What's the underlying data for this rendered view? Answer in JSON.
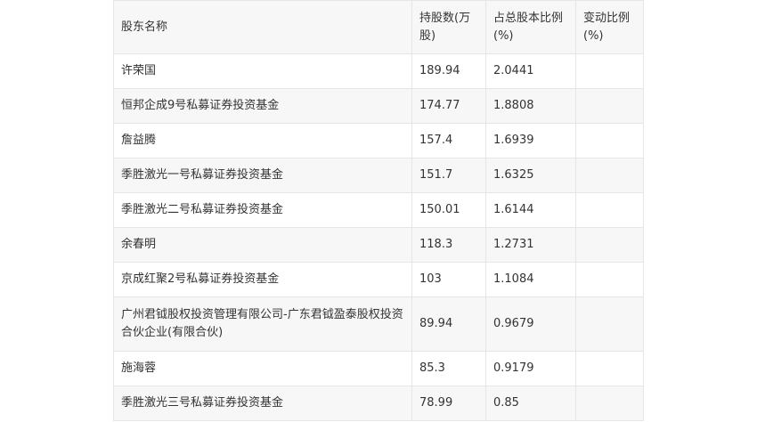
{
  "table": {
    "headers": {
      "name": "股东名称",
      "shares": "持股数(万股)",
      "ratio": "占总股本比例(%)",
      "change": "变动比例(%)"
    },
    "rows": [
      {
        "name": "许荣国",
        "shares": "189.94",
        "ratio": "2.0441",
        "change": ""
      },
      {
        "name": "恒邦企成9号私募证券投资基金",
        "shares": "174.77",
        "ratio": "1.8808",
        "change": ""
      },
      {
        "name": "詹益腾",
        "shares": "157.4",
        "ratio": "1.6939",
        "change": ""
      },
      {
        "name": "季胜激光一号私募证券投资基金",
        "shares": "151.7",
        "ratio": "1.6325",
        "change": ""
      },
      {
        "name": "季胜激光二号私募证券投资基金",
        "shares": "150.01",
        "ratio": "1.6144",
        "change": ""
      },
      {
        "name": "余春明",
        "shares": "118.3",
        "ratio": "1.2731",
        "change": ""
      },
      {
        "name": "京成红聚2号私募证券投资基金",
        "shares": "103",
        "ratio": "1.1084",
        "change": ""
      },
      {
        "name": "广州君钺股权投资管理有限公司-广东君钺盈泰股权投资合伙企业(有限合伙)",
        "shares": "89.94",
        "ratio": "0.9679",
        "change": ""
      },
      {
        "name": "施海蓉",
        "shares": "85.3",
        "ratio": "0.9179",
        "change": ""
      },
      {
        "name": "季胜激光三号私募证券投资基金",
        "shares": "78.99",
        "ratio": "0.85",
        "change": ""
      }
    ]
  }
}
